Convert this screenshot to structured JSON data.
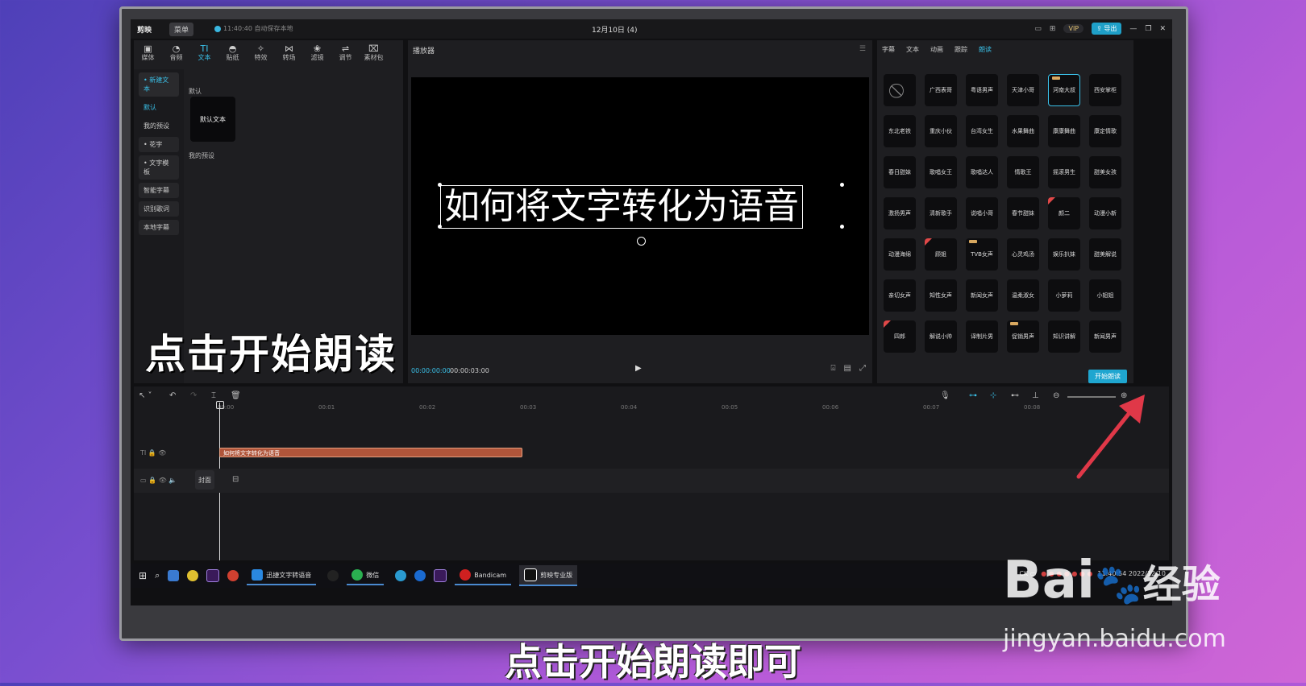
{
  "window": {
    "app_name": "剪映",
    "menu_label": "菜单",
    "autosave": "11:40:40 自动保存本地",
    "project_title": "12月10日 (4)",
    "vip_label": "VIP",
    "export_label": "导出"
  },
  "toolbar": {
    "items": [
      "媒体",
      "音频",
      "文本",
      "贴纸",
      "特效",
      "转场",
      "滤镜",
      "调节",
      "素材包"
    ],
    "active": "文本"
  },
  "sidebar": {
    "items": [
      "• 新建文本",
      "默认",
      "我的预设",
      "• 花字",
      "• 文字模板",
      "智能字幕",
      "识别歌词",
      "本地字幕"
    ]
  },
  "left_panel": {
    "section_default": "默认",
    "default_card": "默认文本",
    "section_my_presets": "我的预设"
  },
  "overlay_caption": "点击开始朗读",
  "player": {
    "title": "播放器",
    "video_text": "如何将文字转化为语音",
    "time_current": "00:00:00:00",
    "time_total": "00:00:03:00"
  },
  "right_panel": {
    "tabs": [
      "字幕",
      "文本",
      "动画",
      "跟踪",
      "朗读"
    ],
    "active_tab": "朗读",
    "voices": [
      "广西表哥",
      "粤语男声",
      "天津小哥",
      "河南大叔",
      "西安掌柜",
      "东北老铁",
      "重庆小伙",
      "台湾女生",
      "水果舞曲",
      "康康舞曲",
      "康定情歌",
      "春日甜妹",
      "歌唱女王",
      "歌唱达人",
      "情歌王",
      "摇滚男生",
      "甜美女孩",
      "激扬男声",
      "清新歌手",
      "说唱小哥",
      "春节甜妹",
      "颜二",
      "动漫小新",
      "动漫海绵",
      "顾姐",
      "TVB女声",
      "心灵鸡汤",
      "娱乐扒妹",
      "甜美解说",
      "亲切女声",
      "知性女声",
      "新闻女声",
      "温柔淑女",
      "小萝莉",
      "小姐姐",
      "四郎",
      "解说小帅",
      "译制片男",
      "促销男声",
      "知识讲解",
      "新闻男声"
    ],
    "selected_voice": "河南大叔",
    "start_button": "开始朗读"
  },
  "timeline": {
    "ruler": [
      "00:00",
      "00:01",
      "00:02",
      "00:03",
      "00:04",
      "00:05",
      "00:06",
      "00:07",
      "00:08"
    ],
    "text_clip": "如何将文字转化为语音",
    "cover_label": "封面"
  },
  "taskbar": {
    "apps": [
      "迅捷文字转语音",
      "微信",
      "Bandicam",
      "剪映专业版"
    ],
    "clock": "11:40:54",
    "date": "2022/12/10"
  },
  "subtitle": "点击开始朗读即可",
  "watermark": {
    "brand_left": "Bai",
    "brand_right": "经验",
    "url": "jingyan.baidu.com"
  }
}
